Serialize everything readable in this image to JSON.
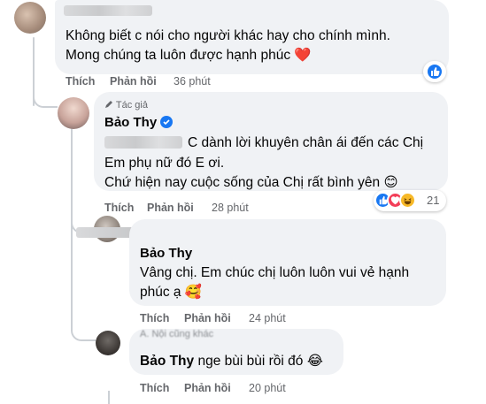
{
  "comment1": {
    "text_line1": "Không biết c nói cho người khác hay cho chính mình.",
    "text_line2": "Mong chúng ta luôn được hạnh phúc",
    "heart_emoji": "❤️",
    "like_label": "Thích",
    "reply_label": "Phản hồi",
    "time": "36 phút",
    "reaction_icon": "like-icon"
  },
  "comment2": {
    "author_badge": "Tác giả",
    "author_name": "Bảo Thy",
    "text_line1": "C dành lời khuyên chân ái đến các Chị",
    "text_line2": "Em phụ nữ đó E ơi.",
    "text_line3": "Chứ hiện nay cuộc sống của Chị rất bình yên",
    "emoji": "😊",
    "like_label": "Thích",
    "reply_label": "Phản hồi",
    "time": "28 phút",
    "reaction_count": "21",
    "reactions": [
      "like",
      "love",
      "haha"
    ],
    "colors": {
      "like": "#1877f2",
      "love": "#f33e58",
      "haha": "#f7b928"
    }
  },
  "reply1": {
    "author_name": "Bảo Thy",
    "text_line1": "Vâng chị. Em chúc chị luôn luôn vui vẻ hạnh",
    "text_line2": "phúc ạ",
    "emoji": "🥰",
    "like_label": "Thích",
    "reply_label": "Phản hồi",
    "time": "24 phút"
  },
  "reply2": {
    "header_partial": "A. Nội cũng khác",
    "tag_name": "Bảo Thy",
    "text": "nge bùi bùi rồi đó",
    "emoji": "😂",
    "like_label": "Thích",
    "reply_label": "Phản hồi",
    "time": "20 phút"
  },
  "icons": [
    "pencil-icon",
    "verified-badge-icon",
    "like-icon",
    "love-icon",
    "haha-icon"
  ]
}
